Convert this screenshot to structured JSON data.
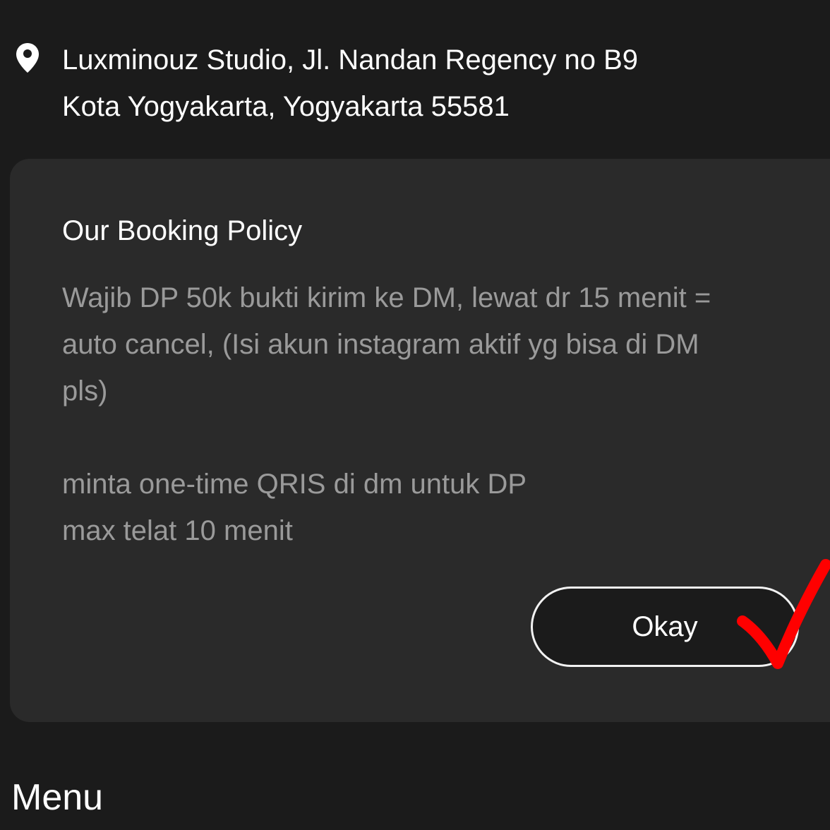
{
  "location": {
    "icon": "map-pin-icon",
    "address_line1": "Luxminouz Studio, Jl. Nandan Regency no B9",
    "address_line2": "Kota Yogyakarta, Yogyakarta 55581"
  },
  "policy": {
    "title": "Our Booking Policy",
    "line1": "Wajib DP 50k bukti kirim ke DM, lewat dr 15 menit =",
    "line2": "auto cancel, (Isi akun instagram aktif yg bisa di DM",
    "line3": "pls)",
    "line4": "minta one-time QRIS di dm untuk DP",
    "line5": "max telat 10 menit",
    "button_label": "Okay"
  },
  "menu": {
    "heading": "Menu"
  },
  "annotation": {
    "icon": "red-checkmark-icon",
    "color": "#ff0000"
  },
  "colors": {
    "background": "#1b1b1b",
    "card": "#2a2a2a",
    "muted_text": "#9a9a9a"
  }
}
